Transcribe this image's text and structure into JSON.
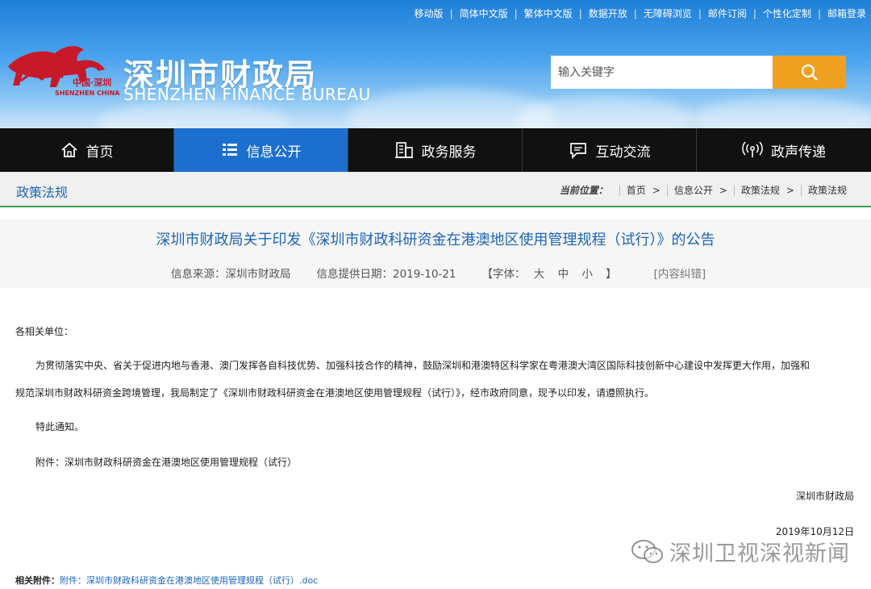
{
  "toplinks": [
    "移动版",
    "简体中文版",
    "繁体中文版",
    "数据开放",
    "无障碍浏览",
    "邮件订阅",
    "个性化定制",
    "邮箱登录"
  ],
  "brand": {
    "logo_text_cn": "中国·深圳",
    "logo_text_en": "SHENZHEN CHINA",
    "title": "深圳市财政局",
    "subtitle": "SHENZHEN FINANCE BUREAU"
  },
  "search": {
    "placeholder": "输入关键字",
    "button_icon": "search-icon"
  },
  "nav": [
    {
      "label": "首页",
      "icon": "home-icon"
    },
    {
      "label": "信息公开",
      "icon": "list-icon",
      "active": true
    },
    {
      "label": "政务服务",
      "icon": "building-icon"
    },
    {
      "label": "互动交流",
      "icon": "chat-icon"
    },
    {
      "label": "政声传递",
      "icon": "broadcast-icon"
    }
  ],
  "section": {
    "title": "政策法规",
    "breadcrumb_label": "当前位置：",
    "breadcrumb": [
      "首页",
      "信息公开",
      "政策法规",
      "政策法规"
    ]
  },
  "article": {
    "title": "深圳市财政局关于印发《深圳市财政科研资金在港澳地区使用管理规程（试行）》的公告",
    "source": "信息来源：深圳市财政局",
    "date": "信息提供日期：2019-10-21",
    "font_label": "【字体：",
    "font_sizes": [
      "大",
      "中",
      "小"
    ],
    "font_close": "】",
    "correction": "[内容纠错]",
    "salutation": "各相关单位：",
    "para1_line1": "为贯彻落实中央、省关于促进内地与香港、澳门发挥各自科技优势、加强科技合作的精神，鼓励深圳和港澳特区科学家在粤港澳大湾区国际科技创新中心建设中发挥更大作用，加强和",
    "para1_line2": "规范深圳市财政科研资金跨境管理，我局制定了《深圳市财政科研资金在港澳地区使用管理规程（试行）》，经市政府同意，现予以印发，请遵照执行。",
    "notice": "特此通知。",
    "attachment_line": "附件：深圳市财政科研资金在港澳地区使用管理规程（试行）",
    "signature": "深圳市财政局",
    "sign_date": "2019年10月12日",
    "related_label": "相关附件：",
    "related_link": "附件：深圳市财政科研资金在港澳地区使用管理规程（试行）.doc"
  },
  "watermark": "深圳卫视深视新闻",
  "colors": {
    "nav_active": "#1c6fcf",
    "nav_bg": "#111111",
    "search_button": "#f0a021",
    "link_blue": "#1c64b8",
    "accent_green": "#2fa84f"
  }
}
